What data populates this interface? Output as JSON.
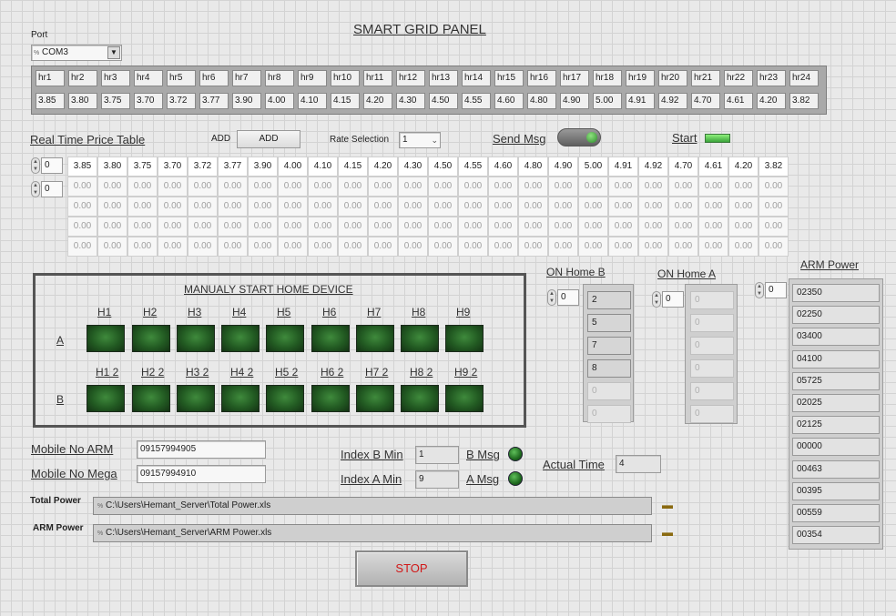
{
  "title": "SMART GRID PANEL",
  "port": {
    "label": "Port",
    "value": "COM3"
  },
  "hours": [
    "hr1",
    "hr2",
    "hr3",
    "hr4",
    "hr5",
    "hr6",
    "hr7",
    "hr8",
    "hr9",
    "hr10",
    "hr11",
    "hr12",
    "hr13",
    "hr14",
    "hr15",
    "hr16",
    "hr17",
    "hr18",
    "hr19",
    "hr20",
    "hr21",
    "hr22",
    "hr23",
    "hr24"
  ],
  "hour_values": [
    "3.85",
    "3.80",
    "3.75",
    "3.70",
    "3.72",
    "3.77",
    "3.90",
    "4.00",
    "4.10",
    "4.15",
    "4.20",
    "4.30",
    "4.50",
    "4.55",
    "4.60",
    "4.80",
    "4.90",
    "5.00",
    "4.91",
    "4.92",
    "4.70",
    "4.61",
    "4.20",
    "3.82"
  ],
  "price_table": {
    "label": "Real Time Price Table",
    "row_index": "0",
    "col_index": "0",
    "rows": [
      [
        "3.85",
        "3.80",
        "3.75",
        "3.70",
        "3.72",
        "3.77",
        "3.90",
        "4.00",
        "4.10",
        "4.15",
        "4.20",
        "4.30",
        "4.50",
        "4.55",
        "4.60",
        "4.80",
        "4.90",
        "5.00",
        "4.91",
        "4.92",
        "4.70",
        "4.61",
        "4.20",
        "3.82"
      ],
      [
        "0.00",
        "0.00",
        "0.00",
        "0.00",
        "0.00",
        "0.00",
        "0.00",
        "0.00",
        "0.00",
        "0.00",
        "0.00",
        "0.00",
        "0.00",
        "0.00",
        "0.00",
        "0.00",
        "0.00",
        "0.00",
        "0.00",
        "0.00",
        "0.00",
        "0.00",
        "0.00",
        "0.00"
      ],
      [
        "0.00",
        "0.00",
        "0.00",
        "0.00",
        "0.00",
        "0.00",
        "0.00",
        "0.00",
        "0.00",
        "0.00",
        "0.00",
        "0.00",
        "0.00",
        "0.00",
        "0.00",
        "0.00",
        "0.00",
        "0.00",
        "0.00",
        "0.00",
        "0.00",
        "0.00",
        "0.00",
        "0.00"
      ],
      [
        "0.00",
        "0.00",
        "0.00",
        "0.00",
        "0.00",
        "0.00",
        "0.00",
        "0.00",
        "0.00",
        "0.00",
        "0.00",
        "0.00",
        "0.00",
        "0.00",
        "0.00",
        "0.00",
        "0.00",
        "0.00",
        "0.00",
        "0.00",
        "0.00",
        "0.00",
        "0.00",
        "0.00"
      ],
      [
        "0.00",
        "0.00",
        "0.00",
        "0.00",
        "0.00",
        "0.00",
        "0.00",
        "0.00",
        "0.00",
        "0.00",
        "0.00",
        "0.00",
        "0.00",
        "0.00",
        "0.00",
        "0.00",
        "0.00",
        "0.00",
        "0.00",
        "0.00",
        "0.00",
        "0.00",
        "0.00",
        "0.00"
      ]
    ]
  },
  "add": {
    "label": "ADD",
    "button": "ADD"
  },
  "rate_selection": {
    "label": "Rate Selection",
    "value": "1"
  },
  "send_msg": {
    "label": "Send Msg"
  },
  "start": {
    "label": "Start"
  },
  "manual": {
    "title": "MANUALY START HOME DEVICE",
    "row_a_label": "A",
    "row_b_label": "B",
    "row_a": [
      "H1",
      "H2",
      "H3",
      "H4",
      "H5",
      "H6",
      "H7",
      "H8",
      "H9"
    ],
    "row_b": [
      "H1 2",
      "H2 2",
      "H3 2",
      "H4 2",
      "H5 2",
      "H6 2",
      "H7 2",
      "H8 2",
      "H9 2"
    ]
  },
  "on_home_b": {
    "label": "ON Home B",
    "index": "0",
    "values": [
      "2",
      "5",
      "7",
      "8",
      "0",
      "0"
    ]
  },
  "on_home_a": {
    "label": "ON Home A",
    "index": "0",
    "values": [
      "0",
      "0",
      "0",
      "0",
      "0",
      "0"
    ]
  },
  "arm_power": {
    "label": "ARM Power",
    "index": "0",
    "values": [
      "02350",
      "02250",
      "03400",
      "04100",
      "05725",
      "02025",
      "02125",
      "00000",
      "00463",
      "00395",
      "00559",
      "00354"
    ]
  },
  "mobile_arm": {
    "label": "Mobile No ARM",
    "value": "09157994905"
  },
  "mobile_mega": {
    "label": "Mobile No Mega",
    "value": "09157994910"
  },
  "index_b_min": {
    "label": "Index B Min",
    "value": "1"
  },
  "index_a_min": {
    "label": "Index A Min",
    "value": "9"
  },
  "b_msg": {
    "label": "B Msg"
  },
  "a_msg": {
    "label": "A Msg"
  },
  "actual_time": {
    "label": "Actual Time",
    "value": "4"
  },
  "total_power": {
    "label": "Total Power",
    "path": "C:\\Users\\Hemant_Server\\Total Power.xls"
  },
  "arm_power_file": {
    "label": "ARM Power",
    "path": "C:\\Users\\Hemant_Server\\ARM Power.xls"
  },
  "stop": {
    "label": "STOP"
  },
  "colors": {
    "led_on": "#2f7a2f",
    "stop_text": "#d11818",
    "frame": "#555555"
  },
  "icons": [
    "folder-icon",
    "dropdown-arrow-icon",
    "spinner-icon",
    "toggle-switch-icon",
    "indicator-led-icon"
  ]
}
